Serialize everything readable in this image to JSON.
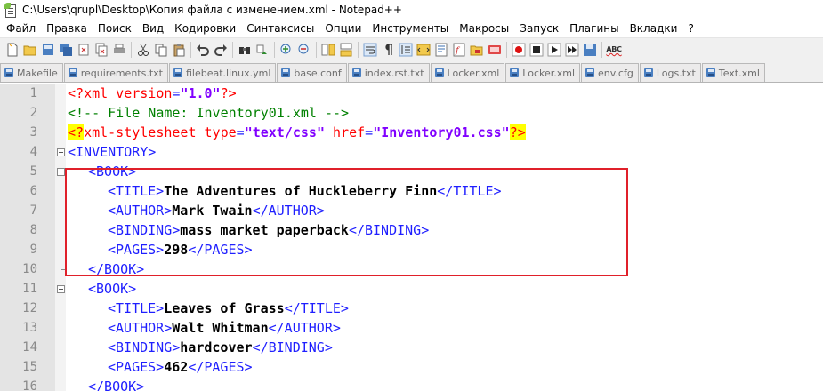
{
  "window": {
    "title": "C:\\Users\\qrupl\\Desktop\\Копия файла с изменением.xml - Notepad++"
  },
  "menu": [
    "Файл",
    "Правка",
    "Поиск",
    "Вид",
    "Кодировки",
    "Синтаксисы",
    "Опции",
    "Инструменты",
    "Макросы",
    "Запуск",
    "Плагины",
    "Вкладки",
    "?"
  ],
  "toolbar": {
    "spellcheck_label": "ABC"
  },
  "tabs": [
    "Makefile",
    "requirements.txt",
    "filebeat.linux.yml",
    "base.conf",
    "index.rst.txt",
    "Locker.xml",
    "Locker.xml",
    "env.cfg",
    "Logs.txt",
    "Text.xml"
  ],
  "lines": [
    {
      "num": "1"
    },
    {
      "num": "2"
    },
    {
      "num": "3"
    },
    {
      "num": "4"
    },
    {
      "num": "5"
    },
    {
      "num": "6"
    },
    {
      "num": "7"
    },
    {
      "num": "8"
    },
    {
      "num": "9"
    },
    {
      "num": "10"
    },
    {
      "num": "11"
    },
    {
      "num": "12"
    },
    {
      "num": "13"
    },
    {
      "num": "14"
    },
    {
      "num": "15"
    },
    {
      "num": "16"
    }
  ],
  "code": {
    "l1": {
      "open": "<?",
      "name": "xml",
      "attr": " version",
      "eq": "=",
      "val": "\"1.0\"",
      "close": "?>"
    },
    "l2": {
      "comment": "<!-- File Name: Inventory01.xml -->"
    },
    "l3": {
      "open": "<?",
      "name": "xml-stylesheet",
      "attr1": " type",
      "eq1": "=",
      "val1": "\"text/css\"",
      "attr2": " href",
      "eq2": "=",
      "val2": "\"Inventory01.css\"",
      "close": "?>"
    },
    "l4": {
      "tag": "<INVENTORY>"
    },
    "l5": {
      "tag": "<BOOK>"
    },
    "l6": {
      "open": "<TITLE>",
      "text": "The Adventures of Huckleberry Finn",
      "close": "</TITLE>"
    },
    "l7": {
      "open": "<AUTHOR>",
      "text": "Mark Twain",
      "close": "</AUTHOR>"
    },
    "l8": {
      "open": "<BINDING>",
      "text": "mass market paperback",
      "close": "</BINDING>"
    },
    "l9": {
      "open": "<PAGES>",
      "text": "298",
      "close": "</PAGES>"
    },
    "l10": {
      "tag": "</BOOK>"
    },
    "l11": {
      "tag": "<BOOK>"
    },
    "l12": {
      "open": "<TITLE>",
      "text": "Leaves of Grass",
      "close": "</TITLE>"
    },
    "l13": {
      "open": "<AUTHOR>",
      "text": "Walt Whitman",
      "close": "</AUTHOR>"
    },
    "l14": {
      "open": "<BINDING>",
      "text": "hardcover",
      "close": "</BINDING>"
    },
    "l15": {
      "open": "<PAGES>",
      "text": "462",
      "close": "</PAGES>"
    },
    "l16": {
      "tag": "</BOOK>"
    }
  },
  "colors": {
    "tag": "#1f1fff",
    "processing": "#ff0000",
    "value": "#8000ff",
    "comment": "#008000",
    "match_highlight": "#ffff00",
    "annotation_box": "#e0202a"
  }
}
